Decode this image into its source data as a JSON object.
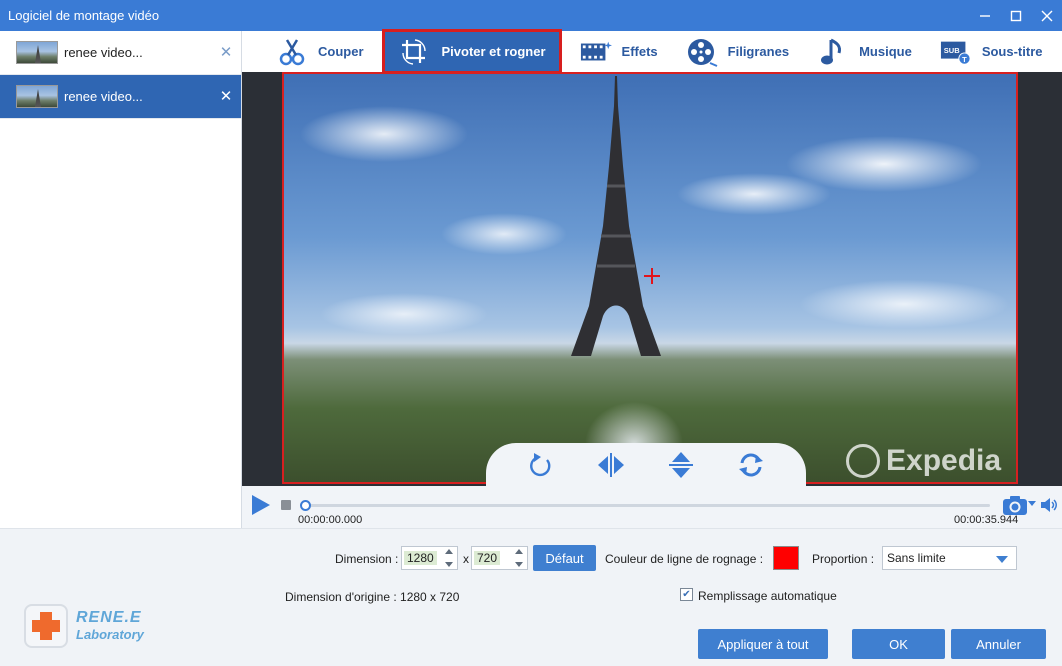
{
  "window": {
    "title": "Logiciel de montage vidéo"
  },
  "files": [
    {
      "name": "renee video...",
      "active": false
    },
    {
      "name": "renee video...",
      "active": true
    }
  ],
  "toolbar": {
    "tabs": [
      {
        "label": "Couper",
        "icon": "scissors-icon"
      },
      {
        "label": "Pivoter et rogner",
        "icon": "crop-icon",
        "active": true
      },
      {
        "label": "Effets",
        "icon": "film-effects-icon"
      },
      {
        "label": "Filigranes",
        "icon": "reel-icon"
      },
      {
        "label": "Musique",
        "icon": "music-note-icon"
      },
      {
        "label": "Sous-titre",
        "icon": "subtitle-icon"
      }
    ]
  },
  "player": {
    "watermark": "Expedia",
    "time_current": "00:00:00.000",
    "time_total": "00:00:35.944",
    "progress": 0
  },
  "crop": {
    "dimension_label": "Dimension :",
    "width": "1280",
    "times": "x",
    "height": "720",
    "default_label": "Défaut",
    "line_color_label": "Couleur de ligne de rognage :",
    "line_color": "#ff0000",
    "proportion_label": "Proportion :",
    "proportion_value": "Sans limite",
    "original_dimension": "Dimension d'origine : 1280 x 720",
    "auto_fill_label": "Remplissage automatique",
    "auto_fill_checked": true
  },
  "logo": {
    "line1": "RENE.E",
    "line2": "Laboratory"
  },
  "actions": {
    "apply_all": "Appliquer à tout",
    "ok": "OK",
    "cancel": "Annuler"
  }
}
